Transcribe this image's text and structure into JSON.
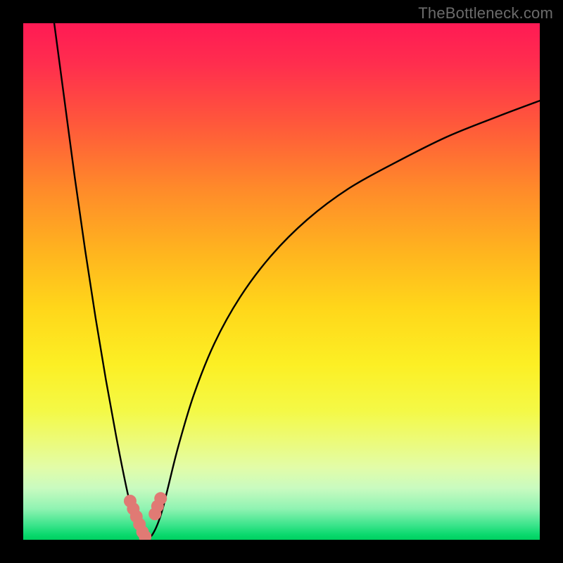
{
  "watermark": "TheBottleneck.com",
  "colors": {
    "frame": "#000000",
    "curve_stroke": "#000000",
    "marker_fill": "#e07a74",
    "gradient_stops": [
      "#ff1a54",
      "#ff2e4e",
      "#ff5a3a",
      "#ff8a2a",
      "#ffb31f",
      "#ffd61a",
      "#fcef24",
      "#f4f946",
      "#ecfb7a",
      "#e2fca8",
      "#c9fbc0",
      "#8ff3b2",
      "#3fe58d",
      "#0ad96e",
      "#00d060"
    ]
  },
  "chart_data": {
    "type": "line",
    "title": "",
    "xlabel": "",
    "ylabel": "",
    "xlim": [
      0,
      100
    ],
    "ylim": [
      0,
      100
    ],
    "grid": false,
    "series": [
      {
        "name": "left-branch",
        "x": [
          6,
          8,
          10,
          12,
          14,
          16,
          18,
          20,
          21,
          22,
          23,
          24
        ],
        "values": [
          100,
          85,
          70,
          56,
          43,
          31,
          20,
          10,
          6,
          3,
          1,
          0
        ]
      },
      {
        "name": "right-branch",
        "x": [
          24,
          25,
          26,
          27,
          28,
          30,
          33,
          37,
          42,
          48,
          55,
          63,
          72,
          82,
          92,
          100
        ],
        "values": [
          0,
          1,
          3,
          6,
          10,
          18,
          28,
          38,
          47,
          55,
          62,
          68,
          73,
          78,
          82,
          85
        ]
      }
    ],
    "markers": [
      {
        "name": "L-cluster",
        "points": [
          [
            20.7,
            7.5
          ],
          [
            21.3,
            6.0
          ],
          [
            21.9,
            4.5
          ],
          [
            22.5,
            3.0
          ],
          [
            23.1,
            1.5
          ],
          [
            23.6,
            0.6
          ]
        ]
      },
      {
        "name": "R-cluster",
        "points": [
          [
            25.5,
            5.0
          ],
          [
            26.0,
            6.5
          ],
          [
            26.6,
            8.0
          ]
        ]
      }
    ],
    "background_color_scale": {
      "low_pct": 0,
      "high_pct": 100,
      "low_color": "green",
      "high_color": "red"
    }
  }
}
